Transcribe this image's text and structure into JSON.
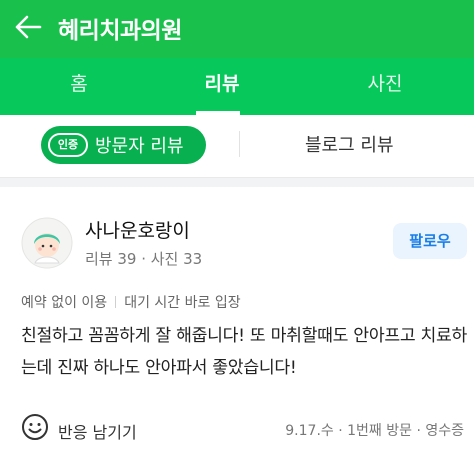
{
  "header": {
    "title": "혜리치과의원"
  },
  "tabs": [
    {
      "label": "홈"
    },
    {
      "label": "리뷰"
    },
    {
      "label": "사진"
    }
  ],
  "subtabs": {
    "visitor_badge": "인증",
    "visitor_label": "방문자 리뷰",
    "blog_label": "블로그 리뷰"
  },
  "review": {
    "username": "사나운호랑이",
    "stats": "리뷰 39 · 사진 33",
    "follow_label": "팔로우",
    "tags": [
      "예약 없이 이용",
      "대기 시간 바로 입장"
    ],
    "text": "친절하고 꼼꼼하게 잘 해줍니다! 또 마취할때도 안아프고 치료하는데 진짜 하나도 안아파서 좋았습니다!",
    "reaction_label": "반응 남기기",
    "visit_meta": "9.17.수 · 1번째 방문 · 영수증"
  },
  "colors": {
    "header": "#19c04b",
    "tabs": "#07c85a",
    "pill": "#08b04f",
    "follow_text": "#1a7ee8"
  }
}
